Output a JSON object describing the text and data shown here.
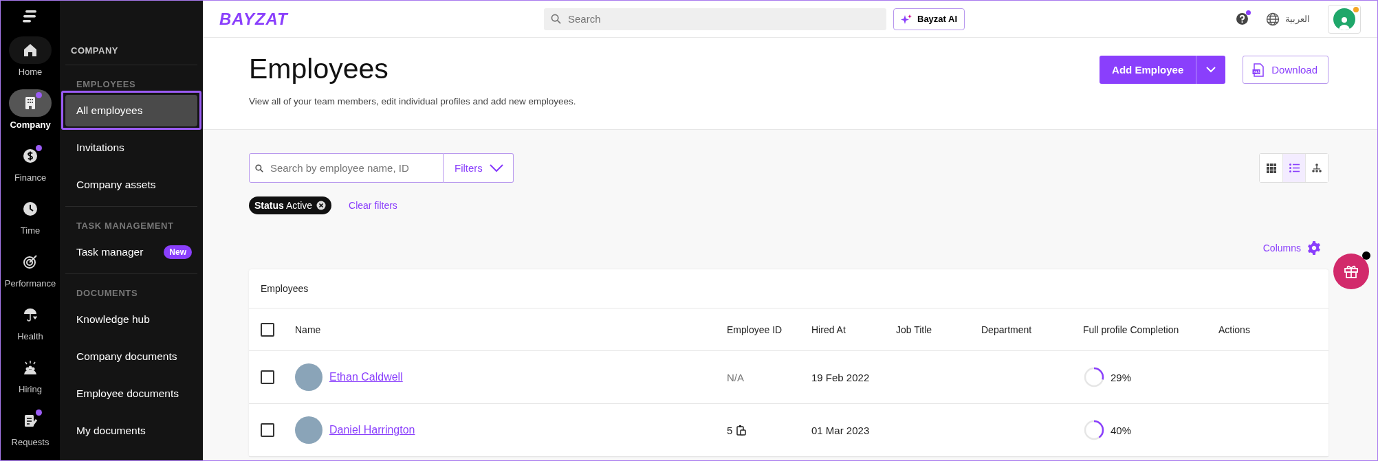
{
  "rail": {
    "items": [
      {
        "label": "Home",
        "selected": false,
        "badge": false
      },
      {
        "label": "Company",
        "selected": true,
        "badge": true
      },
      {
        "label": "Finance",
        "selected": false,
        "badge": true
      },
      {
        "label": "Time",
        "selected": false,
        "badge": false
      },
      {
        "label": "Performance",
        "selected": false,
        "badge": false
      },
      {
        "label": "Health",
        "selected": false,
        "badge": false
      },
      {
        "label": "Hiring",
        "selected": false,
        "badge": false
      },
      {
        "label": "Requests",
        "selected": false,
        "badge": true
      }
    ]
  },
  "company_nav": {
    "title": "COMPANY",
    "sections": [
      {
        "heading": "EMPLOYEES",
        "items": [
          {
            "label": "All employees",
            "selected": true,
            "highlighted": true
          },
          {
            "label": "Invitations",
            "selected": false,
            "highlighted": false
          },
          {
            "label": "Company assets",
            "selected": false,
            "highlighted": false
          }
        ]
      },
      {
        "heading": "TASK MANAGEMENT",
        "items": [
          {
            "label": "Task manager",
            "selected": false,
            "highlighted": false,
            "badge": "New"
          }
        ]
      },
      {
        "heading": "DOCUMENTS",
        "items": [
          {
            "label": "Knowledge hub",
            "selected": false,
            "highlighted": false
          },
          {
            "label": "Company documents",
            "selected": false,
            "highlighted": false
          },
          {
            "label": "Employee documents",
            "selected": false,
            "highlighted": false
          },
          {
            "label": "My documents",
            "selected": false,
            "highlighted": false
          }
        ]
      }
    ]
  },
  "topbar": {
    "logo": "BAYZAT",
    "search": {
      "placeholder": "Search"
    },
    "ai_button": "Bayzat AI",
    "help_badge": true,
    "language": "العربية",
    "avatar_badge": true
  },
  "page": {
    "title": "Employees",
    "subtitle": "View all of your team members, edit individual profiles and add new employees.",
    "add_button": "Add Employee",
    "download_button": "Download"
  },
  "toolbar": {
    "search": {
      "placeholder": "Search by employee name, ID"
    },
    "filters_button": "Filters",
    "views": [
      {
        "kind": "grid",
        "selected": false
      },
      {
        "kind": "list",
        "selected": true
      },
      {
        "kind": "org",
        "selected": false
      }
    ]
  },
  "active_filters": [
    {
      "key": "Status",
      "value": "Active"
    }
  ],
  "clear_filters": "Clear filters",
  "columns_button": "Columns",
  "table": {
    "title": "Employees",
    "header_checked": false,
    "columns": [
      "Name",
      "Employee ID",
      "Hired At",
      "Job Title",
      "Department",
      "Full profile Completion",
      "Actions"
    ],
    "rows": [
      {
        "checked": false,
        "name": "Ethan Caldwell",
        "employee_id": "N/A",
        "id_copy": false,
        "hired_at": "19 Feb 2022",
        "level": 0.29,
        "completion": "29%"
      },
      {
        "checked": false,
        "name": "Daniel Harrington",
        "employee_id": "5",
        "id_copy": true,
        "hired_at": "01 Mar 2023",
        "level": 0.4,
        "completion": "40%"
      }
    ]
  }
}
